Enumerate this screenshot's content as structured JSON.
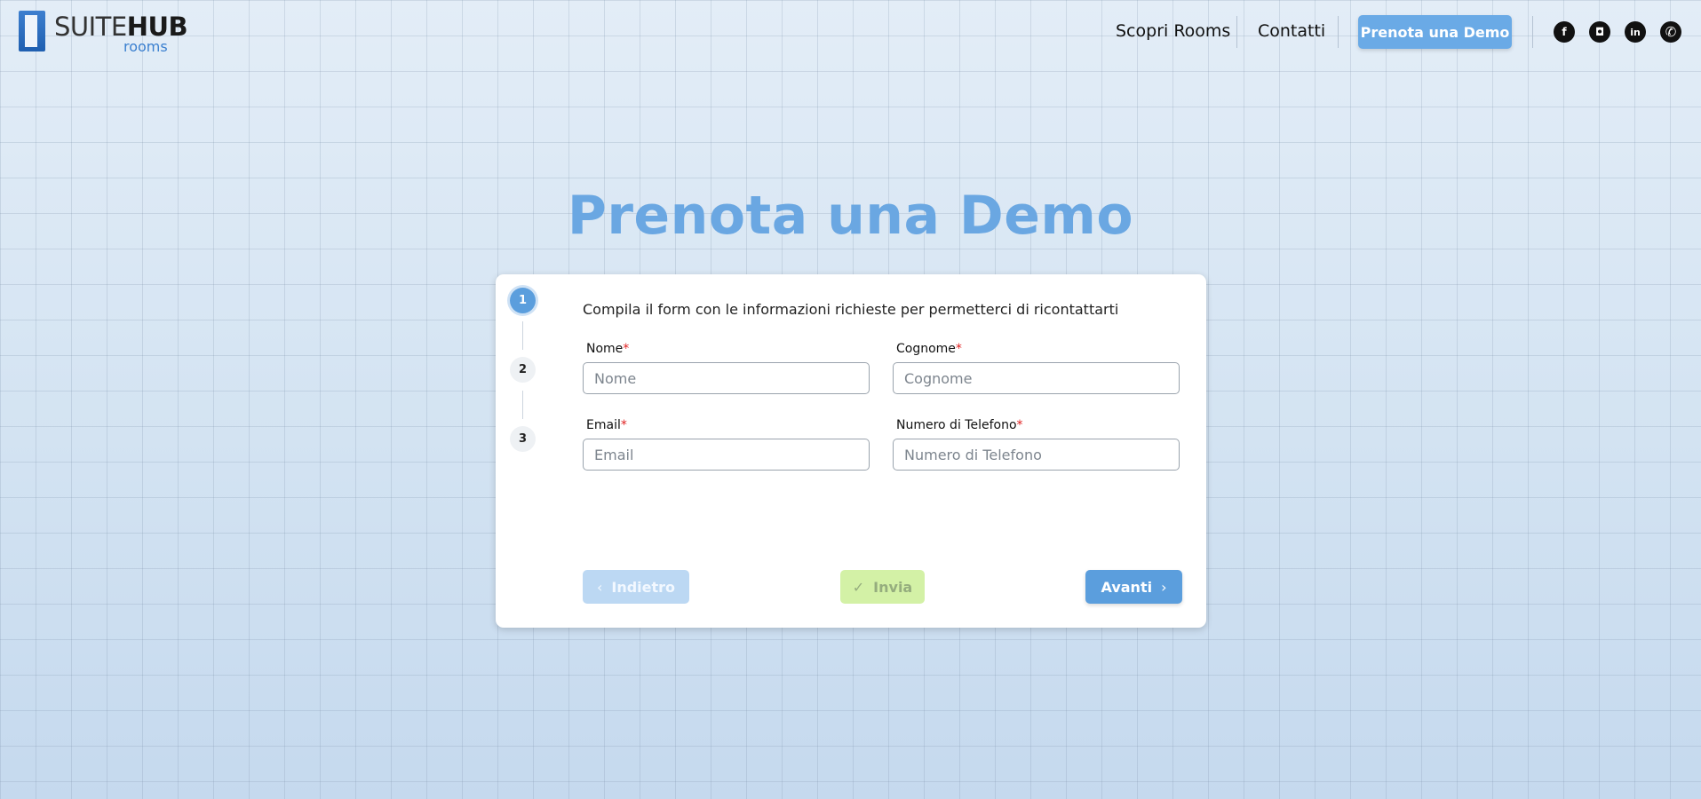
{
  "brand": {
    "word_light": "SUITE",
    "word_bold": "HUB",
    "sub": "rooms"
  },
  "nav": {
    "links": [
      "Scopri Rooms",
      "Contatti"
    ],
    "cta_label": "Prenota una Demo",
    "social": [
      {
        "name": "facebook-icon",
        "glyph": "f"
      },
      {
        "name": "instagram-icon",
        "glyph": "◘"
      },
      {
        "name": "linkedin-icon",
        "glyph": "in"
      },
      {
        "name": "whatsapp-icon",
        "glyph": "✆"
      }
    ]
  },
  "hero": {
    "title": "Prenota una Demo"
  },
  "steps": [
    "1",
    "2",
    "3"
  ],
  "form": {
    "instructions": "Compila il form con le informazioni richieste per permetterci di ricontattarti",
    "required_mark": "*",
    "fields": {
      "nome": {
        "label": "Nome",
        "placeholder": "Nome",
        "value": ""
      },
      "cognome": {
        "label": "Cognome",
        "placeholder": "Cognome",
        "value": ""
      },
      "email": {
        "label": "Email",
        "placeholder": "Email",
        "value": ""
      },
      "telefono": {
        "label": "Numero di Telefono",
        "placeholder": "Numero di Telefono",
        "value": ""
      }
    }
  },
  "buttons": {
    "back": {
      "label": "Indietro",
      "icon": "‹"
    },
    "send": {
      "label": "Invia",
      "icon": "✓"
    },
    "next": {
      "label": "Avanti",
      "icon": "›"
    }
  },
  "colors": {
    "accent": "#5b9edd",
    "title": "#6aa7e2",
    "send_disabled": "#d3f1a6",
    "back_disabled": "#bcd8f3",
    "required": "#e02020"
  }
}
